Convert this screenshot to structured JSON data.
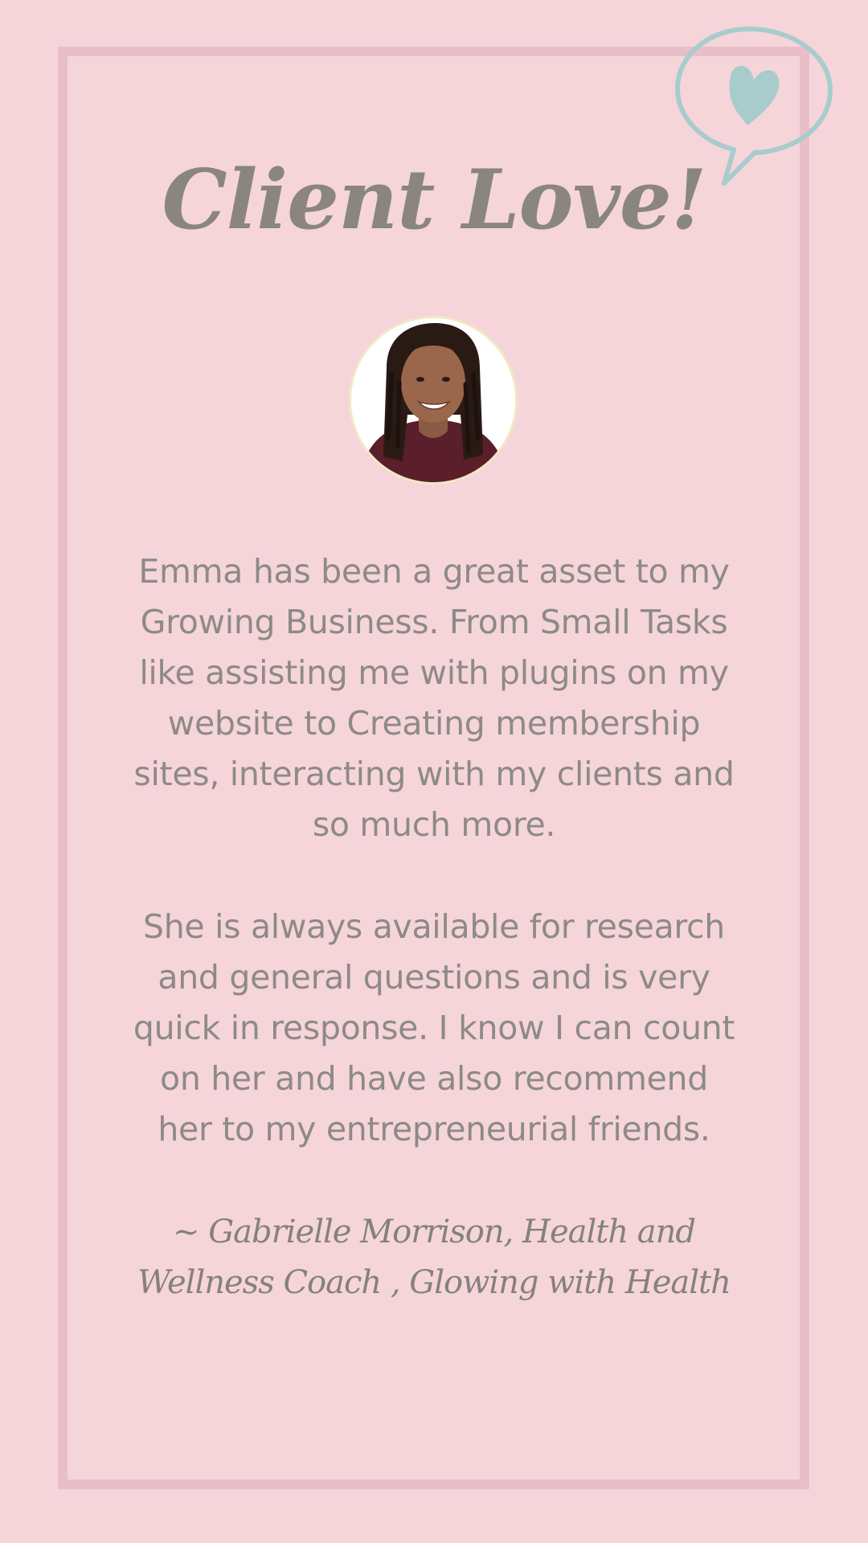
{
  "card": {
    "title": "Client Love!",
    "icon": "heart-speech-bubble-icon",
    "accent_color": "#a8cccc",
    "background_color": "#f5d5da",
    "frame_color": "#e8bfc8",
    "text_color": "#8e8a86"
  },
  "avatar": {
    "description_icon": "client-photo"
  },
  "testimonial": {
    "paragraph1_lines": [
      "Emma has been a great asset to my",
      "Growing Business. From Small Tasks",
      "like assisting me with plugins on my",
      "website to Creating membership",
      "sites, interacting with my clients and",
      "so much more."
    ],
    "paragraph2_lines": [
      "She is always available for research",
      "and general questions and is very",
      "quick in response. I know I can count",
      "on her and have also recommend",
      "her to my entrepreneurial friends."
    ]
  },
  "attribution": {
    "lines": [
      "~ Gabrielle Morrison, Health and",
      "Wellness Coach , Glowing with Health"
    ]
  }
}
